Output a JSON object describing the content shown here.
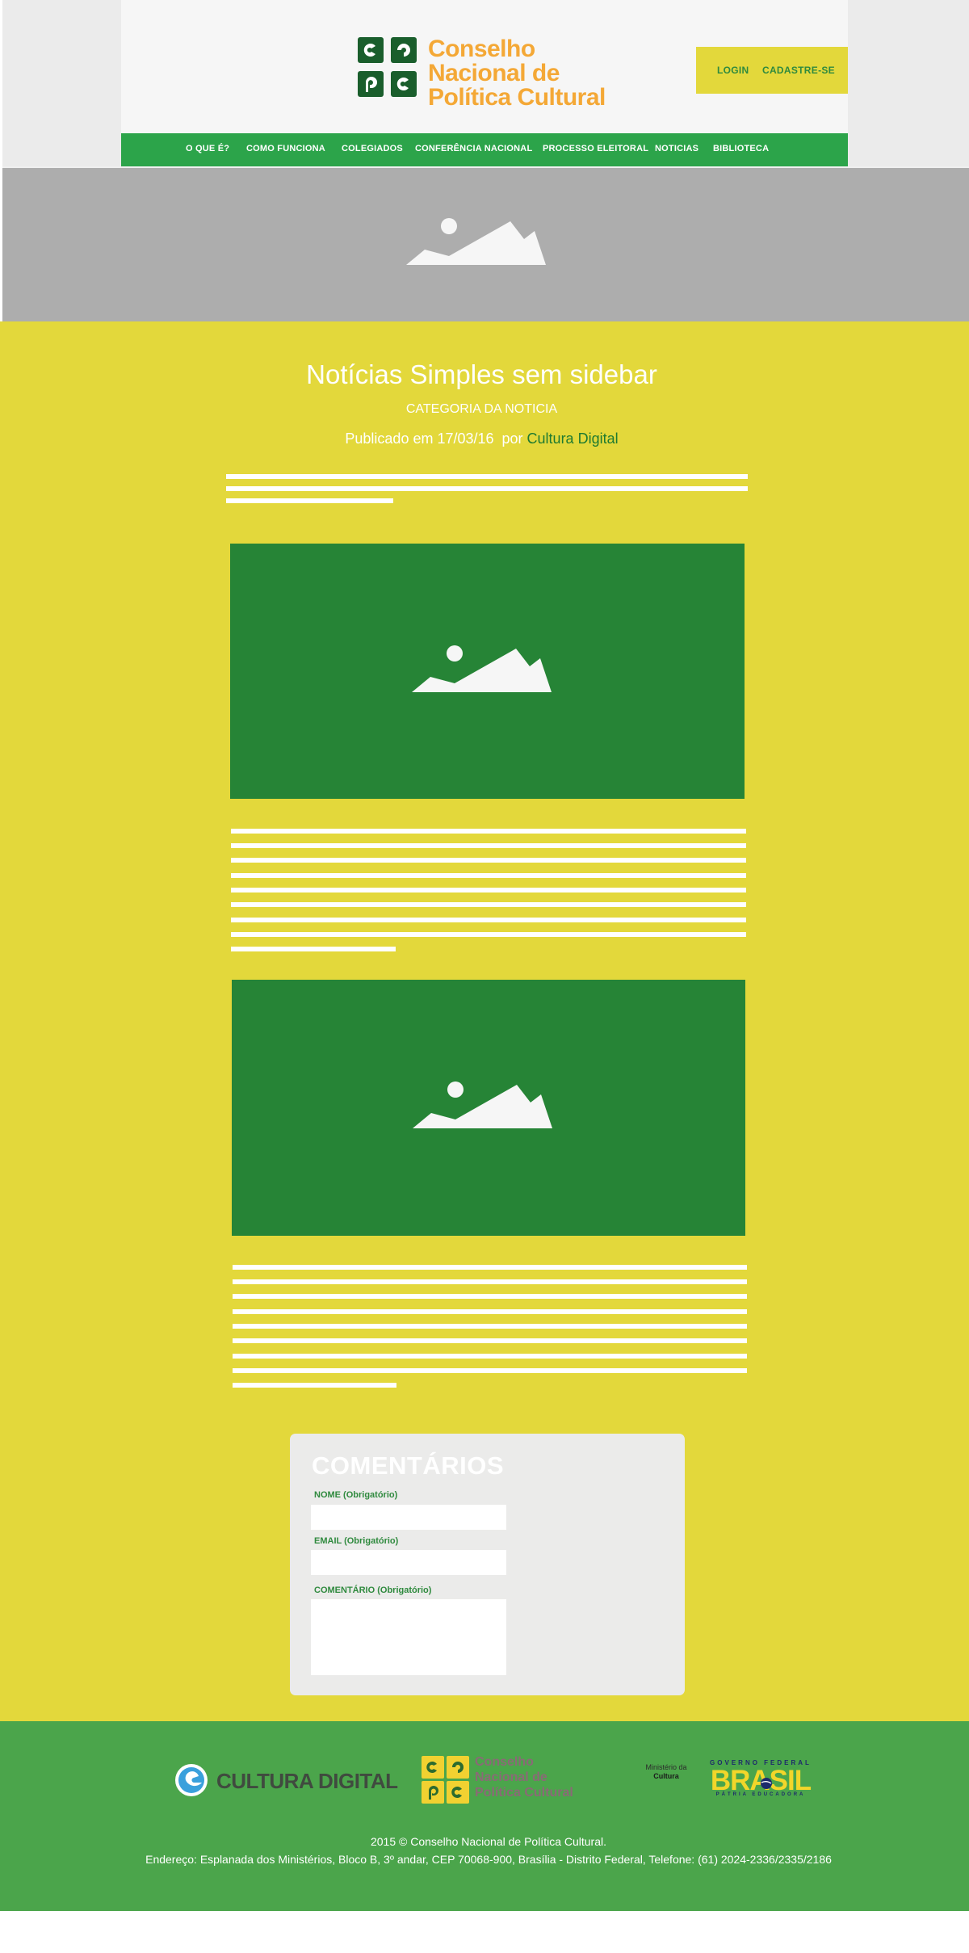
{
  "header": {
    "logo": {
      "line1": "Conselho",
      "line2": "Nacional de",
      "line3": "Política Cultural"
    },
    "login_label": "LOGIN",
    "signup_label": "CADASTRE-SE"
  },
  "nav": {
    "items": [
      {
        "label": "O QUE É?"
      },
      {
        "label": "COMO FUNCIONA"
      },
      {
        "label": "COLEGIADOS"
      },
      {
        "label": "CONFERÊNCIA NACIONAL"
      },
      {
        "label": "PROCESSO ELEITORAL"
      },
      {
        "label": "NOTICIAS"
      },
      {
        "label": "BIBLIOTECA"
      }
    ]
  },
  "post": {
    "title": "Notícias Simples sem sidebar",
    "category": "CATEGORIA DA NOTICIA",
    "published_prefix": "Publicado em 17/03/16  por ",
    "author": "Cultura Digital"
  },
  "comments": {
    "title": "COMENTÁRIOS",
    "name_label": "NOME (Obrigatório)",
    "email_label": "EMAIL (Obrigatório)",
    "comment_label": "COMENTÁRIO (Obrigatório)",
    "name_value": "",
    "email_value": "",
    "comment_value": ""
  },
  "footer": {
    "cultura_digital": "CULTURA DIGITAL",
    "cnpc_line1": "Conselho",
    "cnpc_line2": "Nacional de",
    "cnpc_line3": "Política Cultural",
    "minc_line1": "Ministério da",
    "minc_line2": "Cultura",
    "brasil_top": "GOVERNO FEDERAL",
    "brasil_word": "BRASIL",
    "brasil_bottom": "PÁTRIA EDUCADORA",
    "copyright": "2015 © Conselho Nacional de Política Cultural.",
    "address": "Endereço: Esplanada dos Ministérios, Bloco B, 3º andar, CEP 70068-900, Brasília - Distrito Federal, Telefone: (61) 2024-2336/2335/2186"
  },
  "colors": {
    "brand_green": "#2ca44a",
    "dark_green": "#268436",
    "yellow": "#e3d83b",
    "orange": "#f4a836",
    "footer_green": "#4ba54b"
  },
  "icons": [
    "image-placeholder-icon",
    "cnpc-logo-icon",
    "cultura-digital-logo-icon",
    "brasil-flag-icon"
  ]
}
